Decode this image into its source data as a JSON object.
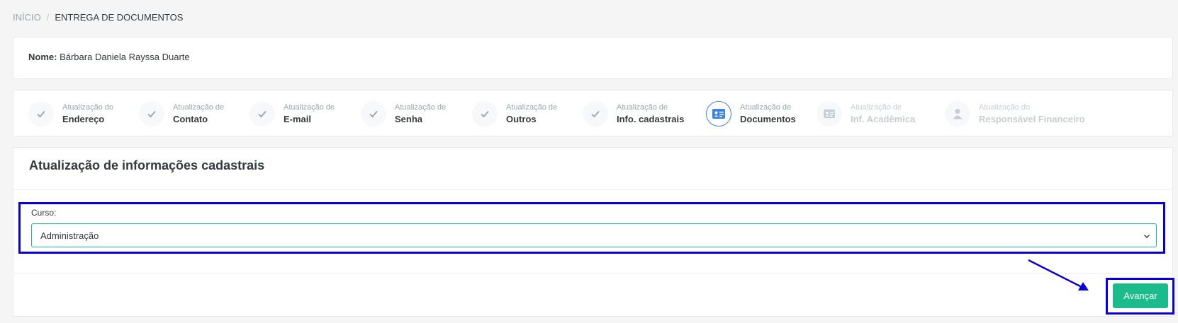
{
  "breadcrumb": {
    "home": "INÍCIO",
    "separator": "/",
    "current": "ENTREGA DE DOCUMENTOS"
  },
  "student": {
    "name_label": "Nome:",
    "name_value": "Bárbara Daniela Rayssa Duarte"
  },
  "steps": [
    {
      "small": "Atualização do",
      "big": "Endereço",
      "state": "done",
      "icon": "check-icon"
    },
    {
      "small": "Atualização de",
      "big": "Contato",
      "state": "done",
      "icon": "check-icon"
    },
    {
      "small": "Atualização de",
      "big": "E-mail",
      "state": "done",
      "icon": "check-icon"
    },
    {
      "small": "Atualização de",
      "big": "Senha",
      "state": "done",
      "icon": "check-icon"
    },
    {
      "small": "Atualização de",
      "big": "Outros",
      "state": "done",
      "icon": "check-icon"
    },
    {
      "small": "Atualização de",
      "big": "Info. cadastrais",
      "state": "done",
      "icon": "check-icon"
    },
    {
      "small": "Atualização de",
      "big": "Documentos",
      "state": "active",
      "icon": "id-card-icon"
    },
    {
      "small": "Atualização de",
      "big": "Inf. Acadêmica",
      "state": "pending",
      "icon": "id-card-icon"
    },
    {
      "small": "Atualização do",
      "big": "Responsável Financeiro",
      "state": "pending",
      "icon": "user-icon"
    }
  ],
  "main": {
    "title": "Atualização de informações cadastrais",
    "curso_label": "Curso:",
    "curso_value": "Administração",
    "next_button": "Avançar"
  },
  "colors": {
    "accent": "#1cbb8c",
    "active_step": "#3b82e8",
    "highlight_box": "#0a00d6"
  }
}
